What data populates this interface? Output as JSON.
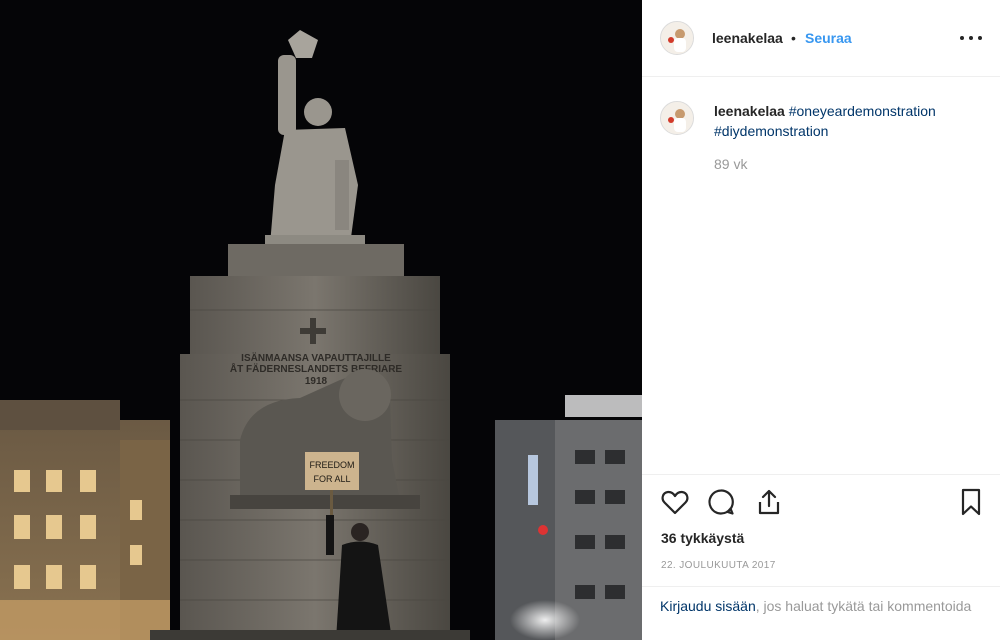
{
  "post": {
    "username": "leenakelaa",
    "separator": "•",
    "follow_label": "Seuraa",
    "caption_tags": [
      "#oneyeardemonstration",
      "#diydemonstration"
    ],
    "posted_ago": "89 vk",
    "likes": "36 tykkäystä",
    "date": "22. JOULUKUUTA 2017",
    "login_link": "Kirjaudu sisään",
    "login_suffix": ", jos haluat tykätä tai kommentoida"
  },
  "photo": {
    "inscription_line1": "ISÄNMAANSA VAPAUTTAJILLE",
    "inscription_line2": "ÅT FÄDERNESLANDETS BEFRIARE",
    "inscription_line3": "1918",
    "sign_line1": "FREEDOM",
    "sign_line2": "FOR ALL"
  },
  "icons": [
    "more-options-icon",
    "heart-icon",
    "comment-icon",
    "share-icon",
    "bookmark-icon"
  ],
  "colors": {
    "follow_blue": "#3897f0",
    "link_navy": "#003569",
    "muted_gray": "#999999",
    "text_dark": "#262626"
  }
}
